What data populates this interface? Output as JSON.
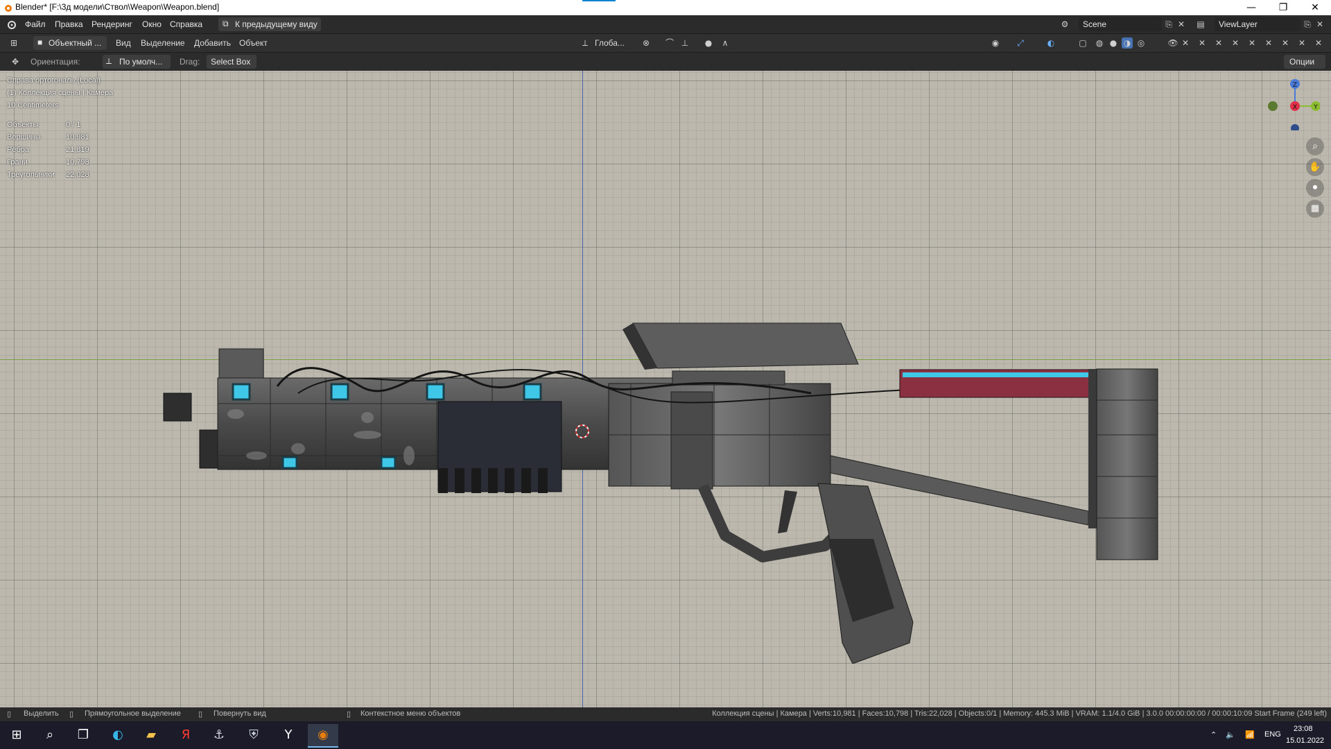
{
  "window": {
    "title": "Blender* [F:\\3д модели\\Ствол\\Weapon\\Weapon.blend]",
    "minimize": "—",
    "restore": "❐",
    "close": "✕"
  },
  "menubar": {
    "items": [
      "Файл",
      "Правка",
      "Рендеринг",
      "Окно",
      "Справка"
    ],
    "back_button": "К предыдущему виду",
    "scene": "Scene",
    "view_layer": "ViewLayer"
  },
  "header": {
    "mode": "Объектный ...",
    "menus": [
      "Вид",
      "Выделение",
      "Добавить",
      "Объект"
    ],
    "transform_orientation": "Глоба..."
  },
  "toolrow": {
    "orientation_label": "Ориентация:",
    "orientation_value": "По умолч...",
    "drag_label": "Drag:",
    "drag_value": "Select Box",
    "options": "Опции"
  },
  "viewport": {
    "view_name": "Справа ортогональ (Local)",
    "collection": "(1) Коллекция сцены | Камера",
    "scale": "10 Centimeters",
    "stats": [
      {
        "label": "Объекты",
        "value": "0 / 1"
      },
      {
        "label": "Вершины",
        "value": "10,981"
      },
      {
        "label": "Рёбра",
        "value": "21,819"
      },
      {
        "label": "Грани",
        "value": "10,798"
      },
      {
        "label": "Треугольники",
        "value": "22,028"
      }
    ],
    "gizmo": {
      "z": "Z",
      "x": "X",
      "y": "Y"
    }
  },
  "statusbar": {
    "select": "Выделить",
    "box_select": "Прямоугольное выделение",
    "rotate_view": "Повернуть вид",
    "context_menu": "Контекстное меню объектов",
    "info": "Коллекция сцены | Камера | Verts:10,981 | Faces:10,798 | Tris:22,028 | Objects:0/1 | Memory: 445.3 MiB | VRAM: 1.1/4.0 GiB | 3.0.0   00:00:00:00 / 00:00:10:09  Start Frame (249 left)"
  },
  "taskbar": {
    "language": "ENG",
    "time": "23:08",
    "date": "15.01.2022"
  },
  "colors": {
    "viewport_bg": "#bcb8ae",
    "accent_cyan": "#3fc7e8",
    "accent_red": "#8a3040"
  }
}
